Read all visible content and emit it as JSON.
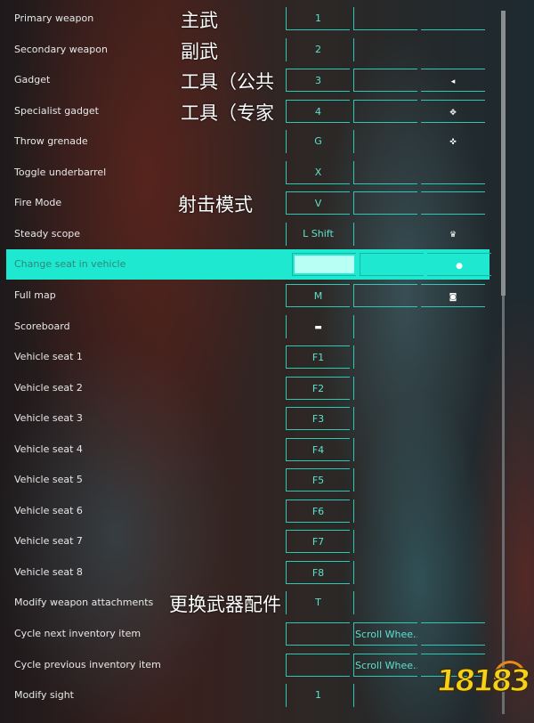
{
  "bindings": [
    {
      "action": "Primary weapon",
      "keys": [
        "1",
        "",
        ""
      ]
    },
    {
      "action": "Secondary weapon",
      "keys": [
        "2",
        "",
        ""
      ]
    },
    {
      "action": "Gadget",
      "keys": [
        "3",
        "",
        "mouse-side-icon"
      ]
    },
    {
      "action": "Specialist gadget",
      "keys": [
        "4",
        "",
        "dpad-icon"
      ]
    },
    {
      "action": "Throw grenade",
      "keys": [
        "G",
        "",
        "dpad-up-icon"
      ]
    },
    {
      "action": "Toggle underbarrel",
      "keys": [
        "X",
        "",
        ""
      ]
    },
    {
      "action": "Fire Mode",
      "keys": [
        "V",
        "",
        ""
      ]
    },
    {
      "action": "Steady scope",
      "keys": [
        "L Shift",
        "",
        "stick-press-icon"
      ]
    },
    {
      "action": "Change seat in vehicle",
      "keys": [
        "",
        "",
        "circle-icon"
      ],
      "selected": true
    },
    {
      "action": "Full map",
      "keys": [
        "M",
        "",
        "touchpad-icon"
      ]
    },
    {
      "action": "Scoreboard",
      "keys": [
        "keyboard-icon",
        "",
        ""
      ]
    },
    {
      "action": "Vehicle seat 1",
      "keys": [
        "F1",
        "",
        ""
      ]
    },
    {
      "action": "Vehicle seat 2",
      "keys": [
        "F2",
        "",
        ""
      ]
    },
    {
      "action": "Vehicle seat 3",
      "keys": [
        "F3",
        "",
        ""
      ]
    },
    {
      "action": "Vehicle seat 4",
      "keys": [
        "F4",
        "",
        ""
      ]
    },
    {
      "action": "Vehicle seat 5",
      "keys": [
        "F5",
        "",
        ""
      ]
    },
    {
      "action": "Vehicle seat 6",
      "keys": [
        "F6",
        "",
        ""
      ]
    },
    {
      "action": "Vehicle seat 7",
      "keys": [
        "F7",
        "",
        ""
      ]
    },
    {
      "action": "Vehicle seat 8",
      "keys": [
        "F8",
        "",
        ""
      ]
    },
    {
      "action": "Modify weapon attachments",
      "keys": [
        "T",
        "",
        ""
      ]
    },
    {
      "action": "Cycle next inventory item",
      "keys": [
        "",
        "Scroll Whee...",
        ""
      ]
    },
    {
      "action": "Cycle previous inventory item",
      "keys": [
        "",
        "Scroll Whee...",
        ""
      ]
    },
    {
      "action": "Modify sight",
      "keys": [
        "1",
        "",
        ""
      ]
    }
  ],
  "annotations": [
    {
      "row": 0,
      "text": "主武"
    },
    {
      "row": 1,
      "text": "副武"
    },
    {
      "row": 2,
      "text": "工具（公共"
    },
    {
      "row": 3,
      "text": "工具（专家"
    },
    {
      "row": 6,
      "text": "射击模式"
    },
    {
      "row": 19,
      "text": "更换武器配件"
    }
  ],
  "watermark": "18183",
  "colors": {
    "accent": "#1ee8d0",
    "key_text": "#5fe0cc",
    "border": "#2fc8b4"
  }
}
